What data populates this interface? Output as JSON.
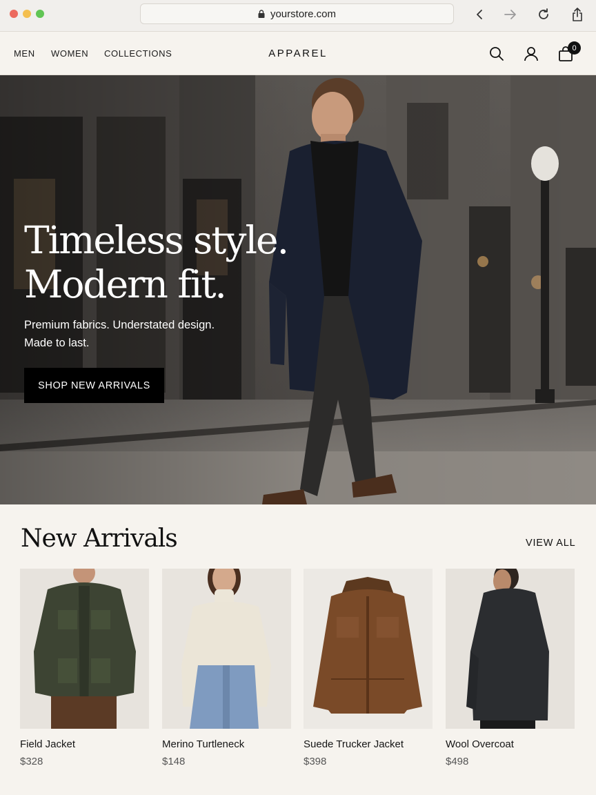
{
  "browser": {
    "url": "yourstore.com"
  },
  "header": {
    "menu": [
      "MEN",
      "WOMEN",
      "COLLECTIONS"
    ],
    "brand": "APPAREL",
    "cart_count": "0"
  },
  "hero": {
    "title": "Timeless style.\nModern fit.",
    "subtitle": "Premium fabrics. Understated design.\nMade to last.",
    "cta": "SHOP NEW ARRIVALS"
  },
  "arrivals": {
    "title": "New Arrivals",
    "view_all": "VIEW ALL",
    "products": [
      {
        "name": "Field Jacket",
        "price": "$328"
      },
      {
        "name": "Merino Turtleneck",
        "price": "$148"
      },
      {
        "name": "Suede Trucker Jacket",
        "price": "$398"
      },
      {
        "name": "Wool Overcoat",
        "price": "$498"
      }
    ]
  },
  "colors": {
    "page_bg": "#f6f3ee",
    "accent": "#000000",
    "traffic_red": "#ec6a5e",
    "traffic_yellow": "#f4bf4f",
    "traffic_green": "#61c554"
  }
}
